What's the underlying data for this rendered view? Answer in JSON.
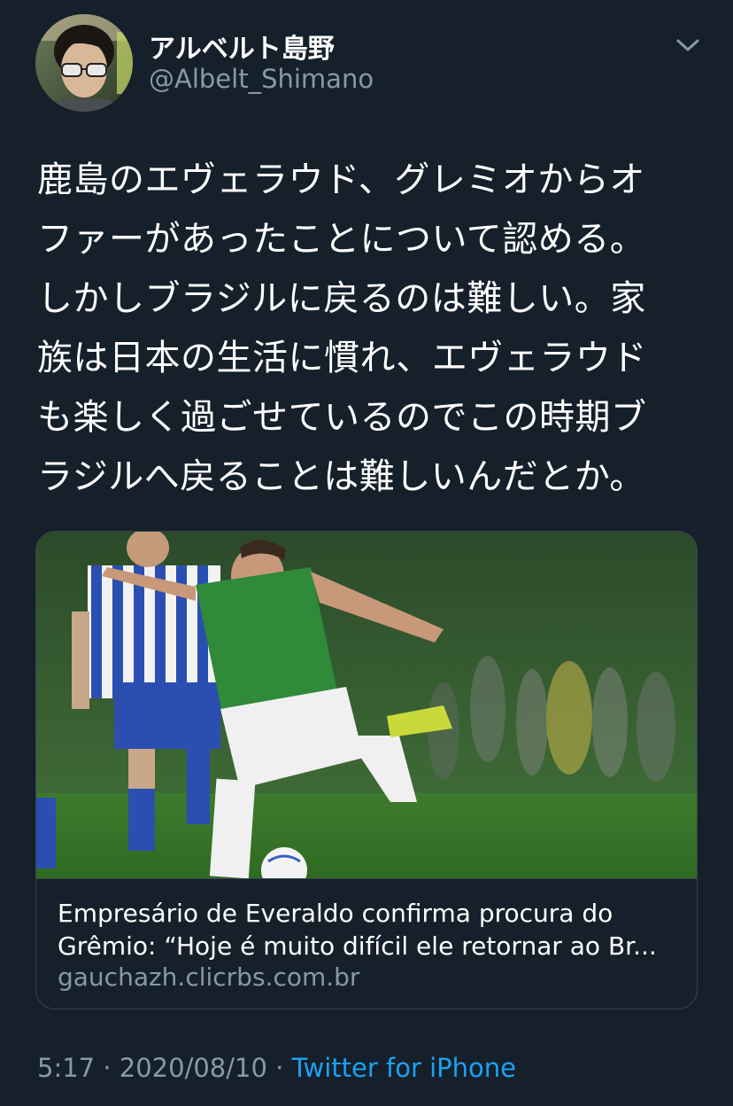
{
  "author": {
    "display_name": "アルベルト島野",
    "handle": "@Albelt_Shimano"
  },
  "tweet": {
    "lines": [
      "鹿島のエヴェラウド、グレミオからオ",
      "ファーがあったことについて認める。",
      "しかしブラジルに戻るのは難しい。家",
      "族は日本の生活に慣れ、エヴェラウド",
      "も楽しく過ごせているのでこの時期ブ",
      "ラジルへ戻ることは難しいんだとか。"
    ]
  },
  "card": {
    "title_lines": [
      "Empresário de Everaldo confirma procura do",
      "Grêmio: “Hoje é muito difícil ele retornar ao Br..."
    ],
    "domain": "gauchazh.clicrbs.com.br",
    "image_icon": "soccer-photo"
  },
  "meta": {
    "time": "5:17",
    "separator": " · ",
    "date": "2020/08/10",
    "separator2": " · ",
    "source": "Twitter for iPhone"
  },
  "colors": {
    "background": "#15202b",
    "secondary_text": "#8899a6",
    "link": "#1da1f2",
    "border": "#38444d"
  },
  "icons": {
    "menu": "chevron-down-icon"
  }
}
